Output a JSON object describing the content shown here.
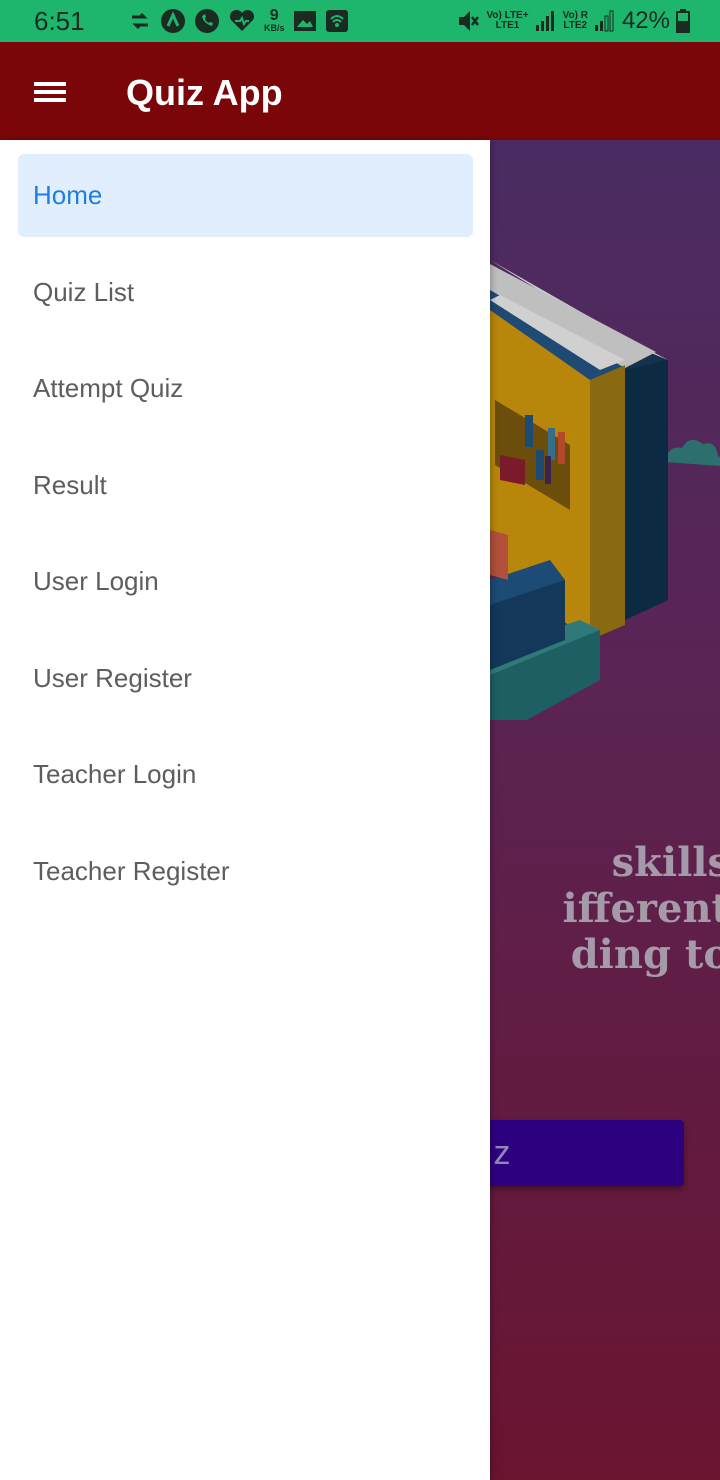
{
  "status_bar": {
    "time": "6:51",
    "data_speed_value": "9",
    "data_speed_unit": "KB/s",
    "sim1_label": "Vo) LTE+",
    "sim1_sub": "LTE1",
    "sim2_label": "Vo) R",
    "sim2_sub": "LTE2",
    "battery_percent": "42%"
  },
  "app_bar": {
    "title": "Quiz App"
  },
  "drawer": {
    "items": [
      {
        "label": "Home",
        "active": true
      },
      {
        "label": "Quiz List",
        "active": false
      },
      {
        "label": "Attempt Quiz",
        "active": false
      },
      {
        "label": "Result",
        "active": false
      },
      {
        "label": "User Login",
        "active": false
      },
      {
        "label": "User Register",
        "active": false
      },
      {
        "label": "Teacher Login",
        "active": false
      },
      {
        "label": "Teacher Register",
        "active": false
      }
    ]
  },
  "main": {
    "text_line1": "skills",
    "text_line2": "ifferent",
    "text_line3": "ding to",
    "button_label": "z"
  },
  "colors": {
    "status_bar": "#1db66c",
    "app_bar": "#7b0609",
    "drawer_active_bg": "#e0eefd",
    "drawer_active_text": "#1e7fe0",
    "button_bg": "#2d007f"
  }
}
